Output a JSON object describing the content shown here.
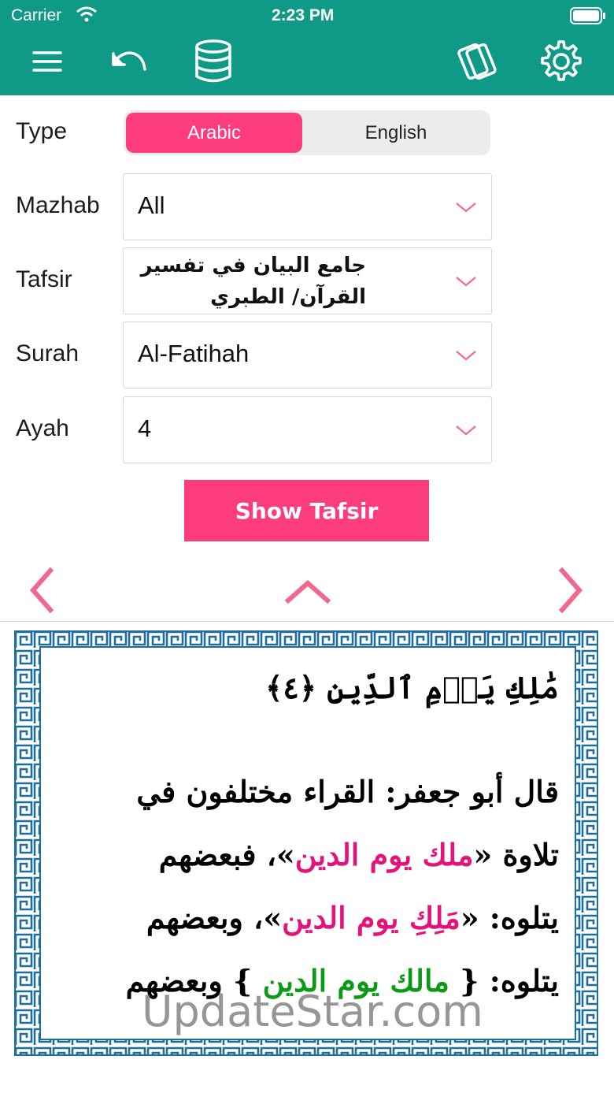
{
  "status": {
    "carrier": "Carrier",
    "time": "2:23 PM"
  },
  "toolbar": {
    "icons": [
      "menu-icon",
      "undo-icon",
      "database-icon",
      "cards-icon",
      "gear-icon"
    ],
    "color": "#0e9a86"
  },
  "form": {
    "type": {
      "label": "Type",
      "options": [
        "Arabic",
        "English"
      ],
      "selected": "Arabic"
    },
    "mazhab": {
      "label": "Mazhab",
      "value": "All"
    },
    "tafsir": {
      "label": "Tafsir",
      "value": "جامع البيان في تفسير القرآن/ الطبري"
    },
    "surah": {
      "label": "Surah",
      "value": "Al-Fatihah"
    },
    "ayah": {
      "label": "Ayah",
      "value": "4"
    },
    "show_button": "Show Tafsir"
  },
  "accent": "#fd3c7d",
  "tafsir_text": {
    "verse": "مَٰلِكِ يَوۡمِ ٱلدِّينِ ﴿٤﴾",
    "lines": [
      {
        "parts": [
          {
            "t": "قال أبو جعفر: القراء مختلفون في",
            "c": ""
          }
        ]
      },
      {
        "parts": [
          {
            "t": "تلاوة «",
            "c": ""
          },
          {
            "t": "ملك يوم الدين",
            "c": "pink"
          },
          {
            "t": "»، فبعضهم",
            "c": ""
          }
        ]
      },
      {
        "parts": [
          {
            "t": "يتلوه: «",
            "c": ""
          },
          {
            "t": "مَلِكِ يوم الدين",
            "c": "pink"
          },
          {
            "t": "»، وبعضهم",
            "c": ""
          }
        ]
      },
      {
        "parts": [
          {
            "t": "يتلوه: { ",
            "c": ""
          },
          {
            "t": "مالك يوم الدين",
            "c": "green"
          },
          {
            "t": " } وبعضهم",
            "c": ""
          }
        ]
      }
    ]
  },
  "watermark": "UpdateStar.com"
}
